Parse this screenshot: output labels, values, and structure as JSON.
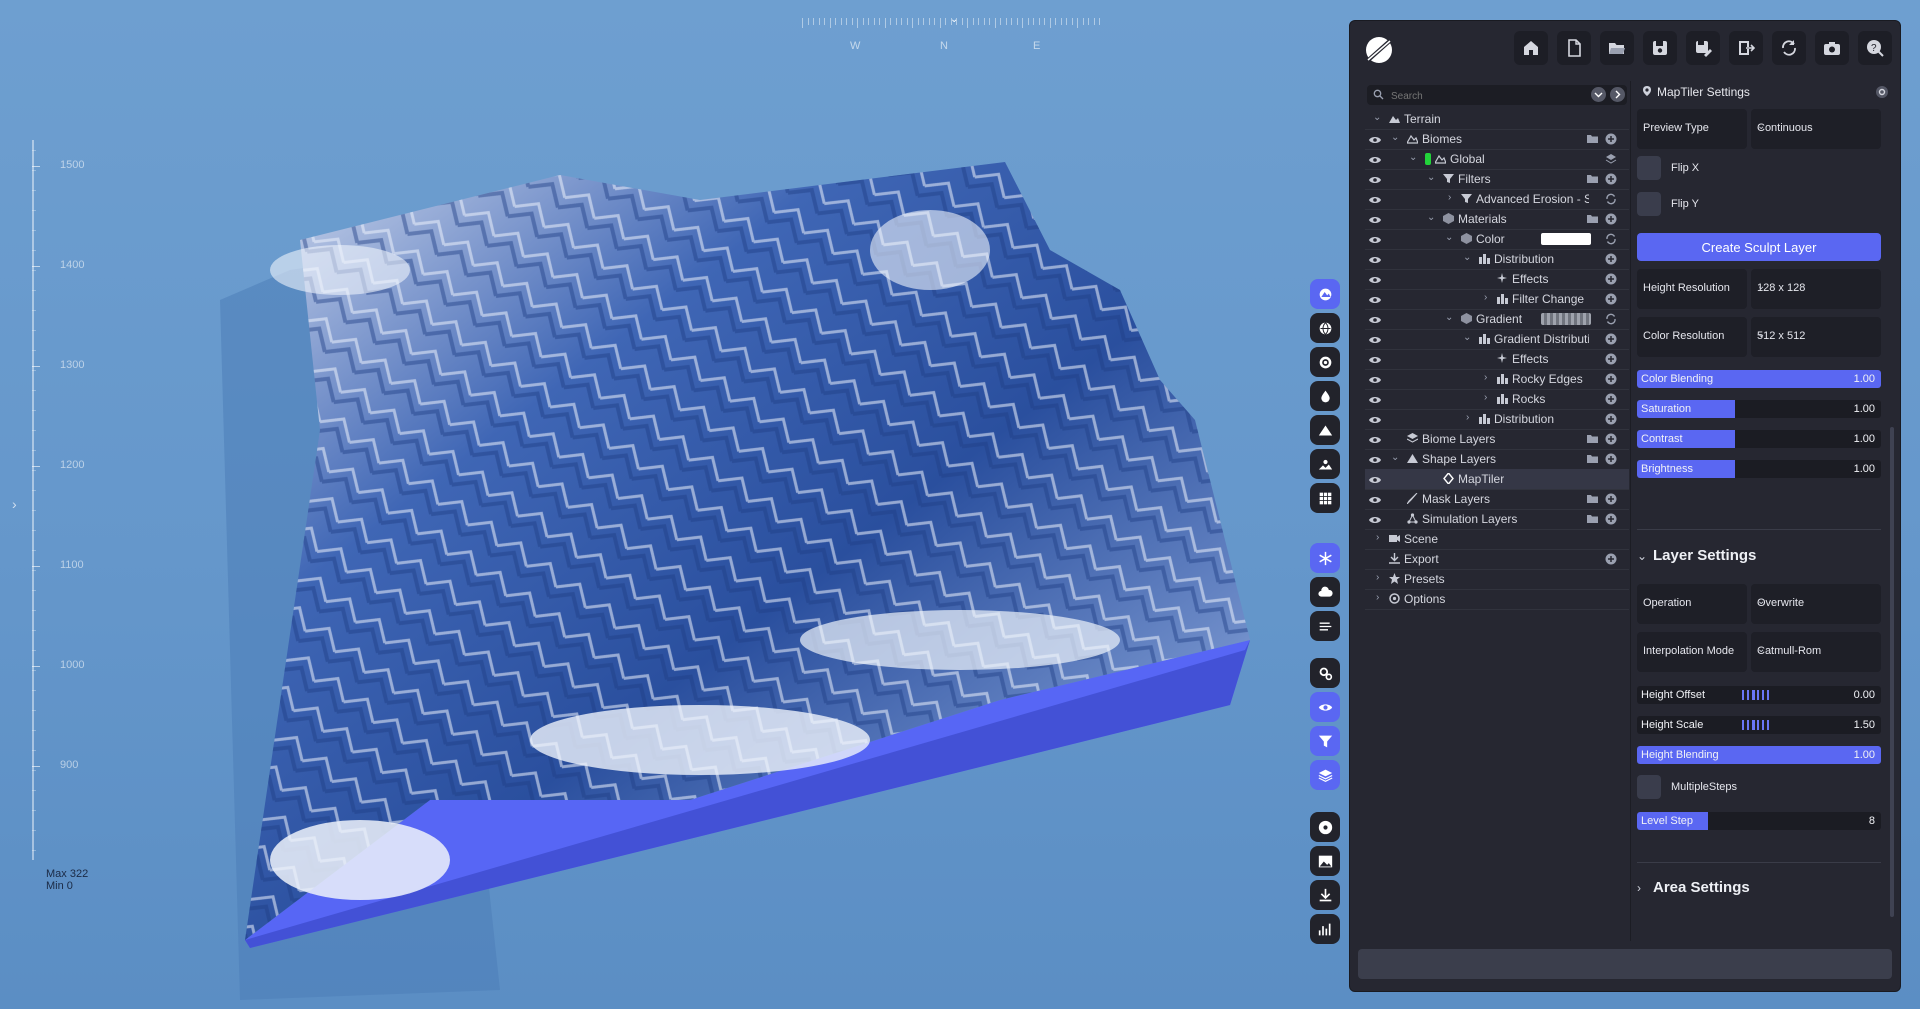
{
  "compass": {
    "labels": [
      "W",
      "N",
      "E"
    ]
  },
  "ruler": {
    "labels": [
      "1500",
      "1400",
      "1300",
      "1200",
      "1100",
      "1000",
      "900"
    ]
  },
  "height_readout": {
    "max": "Max 322",
    "min": "Min 0"
  },
  "toolbar": {
    "groups": [
      [
        "biome-icon",
        "globe-icon",
        "target-icon",
        "water-drop-icon",
        "mountain-icon",
        "landscape-icon",
        "grid-icon"
      ],
      [
        "snowflake-icon",
        "cloud-icon",
        "wind-icon"
      ],
      [
        "cogs-icon",
        "eye-icon",
        "filter-icon",
        "layers-icon"
      ],
      [
        "disc-icon",
        "image-icon",
        "download-icon",
        "chart-icon"
      ]
    ]
  },
  "header": {
    "buttons": [
      "home-icon",
      "new-file-icon",
      "open-folder-icon",
      "save-icon",
      "save-as-icon",
      "export-icon",
      "refresh-icon",
      "camera-icon",
      "help-icon"
    ]
  },
  "tree": {
    "search_placeholder": "Search",
    "items": [
      {
        "label": "Terrain",
        "level": 0,
        "chev": "down",
        "icon": "terrain-icon",
        "eye": false
      },
      {
        "label": "Biomes",
        "level": 1,
        "chev": "down",
        "icon": "biome-icon",
        "eye": true,
        "actions": [
          "folder",
          "plus"
        ]
      },
      {
        "label": "Global",
        "level": 2,
        "chev": "down",
        "icon": "biome-icon",
        "eye": true,
        "marker": "#22d33a",
        "actions": [
          "layers"
        ]
      },
      {
        "label": "Filters",
        "level": 3,
        "chev": "down",
        "icon": "filter-icon",
        "eye": true,
        "actions": [
          "folder",
          "plus"
        ]
      },
      {
        "label": "Advanced Erosion - Sc",
        "level": 4,
        "chev": "right",
        "icon": "filter-icon",
        "eye": true,
        "actions": [
          "refresh"
        ]
      },
      {
        "label": "Materials",
        "level": 3,
        "chev": "down",
        "icon": "material-icon",
        "eye": true,
        "actions": [
          "folder",
          "plus"
        ]
      },
      {
        "label": "Color",
        "level": 4,
        "chev": "down",
        "icon": "material-icon",
        "eye": true,
        "swatch": "white",
        "actions": [
          "refresh"
        ]
      },
      {
        "label": "Distribution",
        "level": 5,
        "chev": "down",
        "icon": "distribution-icon",
        "eye": true,
        "actions": [
          "plus"
        ]
      },
      {
        "label": "Effects",
        "level": 6,
        "chev": "none",
        "icon": "effects-icon",
        "eye": true,
        "actions": [
          "plus"
        ]
      },
      {
        "label": "Filter Change",
        "level": 6,
        "chev": "right",
        "icon": "distribution-icon",
        "eye": true,
        "actions": [
          "plus"
        ]
      },
      {
        "label": "Gradient",
        "level": 4,
        "chev": "down",
        "icon": "material-icon",
        "eye": true,
        "swatch": "gradient",
        "actions": [
          "refresh"
        ]
      },
      {
        "label": "Gradient Distributi",
        "level": 5,
        "chev": "down",
        "icon": "distribution-icon",
        "eye": true,
        "actions": [
          "plus"
        ]
      },
      {
        "label": "Effects",
        "level": 6,
        "chev": "none",
        "icon": "effects-icon",
        "eye": true,
        "actions": [
          "plus"
        ]
      },
      {
        "label": "Rocky Edges",
        "level": 6,
        "chev": "right",
        "icon": "distribution-icon",
        "eye": true,
        "actions": [
          "plus"
        ]
      },
      {
        "label": "Rocks",
        "level": 6,
        "chev": "right",
        "icon": "distribution-icon",
        "eye": true,
        "actions": [
          "plus"
        ]
      },
      {
        "label": "Distribution",
        "level": 5,
        "chev": "right",
        "icon": "distribution-icon",
        "eye": true,
        "actions": [
          "plus"
        ]
      },
      {
        "label": "Biome Layers",
        "level": 1,
        "chev": "none",
        "icon": "layers-icon",
        "eye": true,
        "actions": [
          "folder",
          "plus"
        ]
      },
      {
        "label": "Shape Layers",
        "level": 1,
        "chev": "down",
        "icon": "mountain-icon",
        "eye": true,
        "actions": [
          "folder",
          "plus"
        ]
      },
      {
        "label": "MapTiler",
        "level": 3,
        "chev": "none",
        "icon": "pin-icon",
        "eye": true,
        "selected": true
      },
      {
        "label": "Mask Layers",
        "level": 1,
        "chev": "none",
        "icon": "brush-icon",
        "eye": true,
        "actions": [
          "folder",
          "plus"
        ]
      },
      {
        "label": "Simulation Layers",
        "level": 1,
        "chev": "none",
        "icon": "simulation-icon",
        "eye": true,
        "actions": [
          "folder",
          "plus"
        ]
      },
      {
        "label": "Scene",
        "level": 0,
        "chev": "right",
        "icon": "camera-icon",
        "eye": false
      },
      {
        "label": "Export",
        "level": 0,
        "chev": "none",
        "icon": "download-icon",
        "eye": false,
        "actions": [
          "plus"
        ]
      },
      {
        "label": "Presets",
        "level": 0,
        "chev": "right",
        "icon": "star-icon",
        "eye": false
      },
      {
        "label": "Options",
        "level": 0,
        "chev": "right",
        "icon": "gear-icon",
        "eye": false
      }
    ]
  },
  "settings": {
    "title": "MapTiler Settings",
    "preview_type": {
      "label": "Preview Type",
      "value": "Continuous"
    },
    "flip_x": "Flip X",
    "flip_y": "Flip Y",
    "create_button": "Create Sculpt Layer",
    "height_resolution": {
      "label": "Height Resolution",
      "value": "128 x 128"
    },
    "color_resolution": {
      "label": "Color Resolution",
      "value": "512 x 512"
    },
    "sliders_top": [
      {
        "label": "Color Blending",
        "value": "1.00",
        "fill": 1.0
      },
      {
        "label": "Saturation",
        "value": "1.00",
        "fill": 0.4
      },
      {
        "label": "Contrast",
        "value": "1.00",
        "fill": 0.4
      },
      {
        "label": "Brightness",
        "value": "1.00",
        "fill": 0.4
      }
    ],
    "layer_settings": "Layer Settings",
    "operation": {
      "label": "Operation",
      "value": "Overwrite"
    },
    "interpolation": {
      "label": "Interpolation Mode",
      "value": "Catmull-Rom"
    },
    "height_offset": {
      "label": "Height Offset",
      "value": "0.00"
    },
    "height_scale": {
      "label": "Height Scale",
      "value": "1.50"
    },
    "height_blending": {
      "label": "Height Blending",
      "value": "1.00",
      "fill": 1.0
    },
    "multiple_steps": "MultipleSteps",
    "level_step": {
      "label": "Level Step",
      "value": "8",
      "fill": 0.29
    },
    "area_settings": "Area Settings"
  },
  "colors": {
    "accent": "#5a67f2",
    "panel": "#262731",
    "sky": "#6597cb"
  }
}
